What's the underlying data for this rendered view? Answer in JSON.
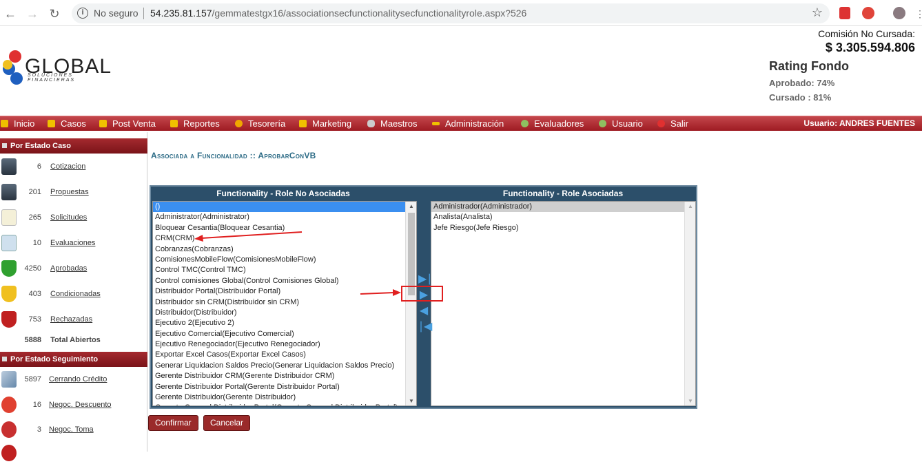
{
  "browser": {
    "security_label": "No seguro",
    "url_host": "54.235.81.157",
    "url_path": "/gemmatestgx16/associationsecfunctionalitysecfunctionalityrole.aspx?526"
  },
  "header": {
    "logo_text": "GLOBAL",
    "logo_subtitle": "SOLUCIONES FINANCIERAS",
    "comision_label": "Comisión No Cursada:",
    "comision_value": "$ 3.305.594.806",
    "rating_title": "Rating Fondo",
    "aprobado": "Aprobado: 74%",
    "cursado": "Cursado : 81%"
  },
  "menu": {
    "items": [
      {
        "label": "Inicio",
        "icon": "home-icon",
        "color": "#f0c000"
      },
      {
        "label": "Casos",
        "icon": "folder-icon",
        "color": "#f0c000"
      },
      {
        "label": "Post Venta",
        "icon": "folder-icon",
        "color": "#f0c000"
      },
      {
        "label": "Reportes",
        "icon": "folder-icon",
        "color": "#f0c000"
      },
      {
        "label": "Tesorería",
        "icon": "coin-icon",
        "color": "#f0a800"
      },
      {
        "label": "Marketing",
        "icon": "monitor-icon",
        "color": "#f0c000"
      },
      {
        "label": "Maestros",
        "icon": "database-icon",
        "color": "#cccccc"
      },
      {
        "label": "Administración",
        "icon": "key-icon",
        "color": "#f0c000"
      },
      {
        "label": "Evaluadores",
        "icon": "users-icon",
        "color": "#8fbf60"
      },
      {
        "label": "Usuario",
        "icon": "users-icon",
        "color": "#8fbf60"
      },
      {
        "label": "Salir",
        "icon": "exit-icon",
        "color": "#e03030"
      }
    ],
    "user_label": "Usuario:  ANDRES FUENTES"
  },
  "sidebar": {
    "estado_caso_title": "Por Estado Caso",
    "estado_caso": [
      {
        "count": "6",
        "label": "Cotizacion",
        "icon": "calculator-icon"
      },
      {
        "count": "201",
        "label": "Propuestas",
        "icon": "calculator-icon"
      },
      {
        "count": "265",
        "label": "Solicitudes",
        "icon": "document-edit-icon"
      },
      {
        "count": "10",
        "label": "Evaluaciones",
        "icon": "magnifier-icon"
      },
      {
        "count": "4250",
        "label": "Aprobadas",
        "icon": "shield-check-icon"
      },
      {
        "count": "403",
        "label": "Condicionadas",
        "icon": "shield-warning-icon"
      },
      {
        "count": "753",
        "label": "Rechazadas",
        "icon": "shield-x-icon"
      }
    ],
    "total_count": "5888",
    "total_label": "Total Abiertos",
    "seguimiento_title": "Por Estado Seguimiento",
    "seguimiento": [
      {
        "count": "5897",
        "label": "Cerrando Crédito",
        "icon": "money-icon"
      },
      {
        "count": "16",
        "label": "Negoc. Descuento",
        "icon": "percent-tag-icon"
      },
      {
        "count": "3",
        "label": "Negoc. Toma",
        "icon": "car-icon"
      }
    ]
  },
  "main": {
    "title": "Associada a Funcionalidad :: AprobarConVB",
    "left_header": "Functionality - Role No Asociadas",
    "right_header": "Functionality - Role Asociadas",
    "left_options": [
      "()",
      "Administrator(Administrator)",
      "Bloquear Cesantia(Bloquear Cesantia)",
      "CRM(CRM)",
      "Cobranzas(Cobranzas)",
      "ComisionesMobileFlow(ComisionesMobileFlow)",
      "Control TMC(Control TMC)",
      "Control comisiones Global(Control Comisiones Global)",
      "Distribuidor Portal(Distribuidor Portal)",
      "Distribuidor sin CRM(Distribuidor sin CRM)",
      "Distribuidor(Distribuidor)",
      "Ejecutivo 2(Ejecutivo 2)",
      "Ejecutivo Comercial(Ejecutivo Comercial)",
      "Ejecutivo Renegociador(Ejecutivo Renegociador)",
      "Exportar Excel Casos(Exportar Excel Casos)",
      "Generar Liquidacion Saldos Precio(Generar Liquidacion Saldos Precio)",
      "Gerente Distribuidor CRM(Gerente Distribuidor CRM)",
      "Gerente Distribuidor Portal(Gerente Distribuidor Portal)",
      "Gerente Distribuidor(Gerente Distribuidor)",
      "Gerente General Distribuidor Portal(Gerente General Distribuidor Portal)"
    ],
    "right_options": [
      "Administrador(Administrador)",
      "Analista(Analista)",
      "Jefe Riesgo(Jefe Riesgo)"
    ],
    "confirm_label": "Confirmar",
    "cancel_label": "Cancelar"
  }
}
